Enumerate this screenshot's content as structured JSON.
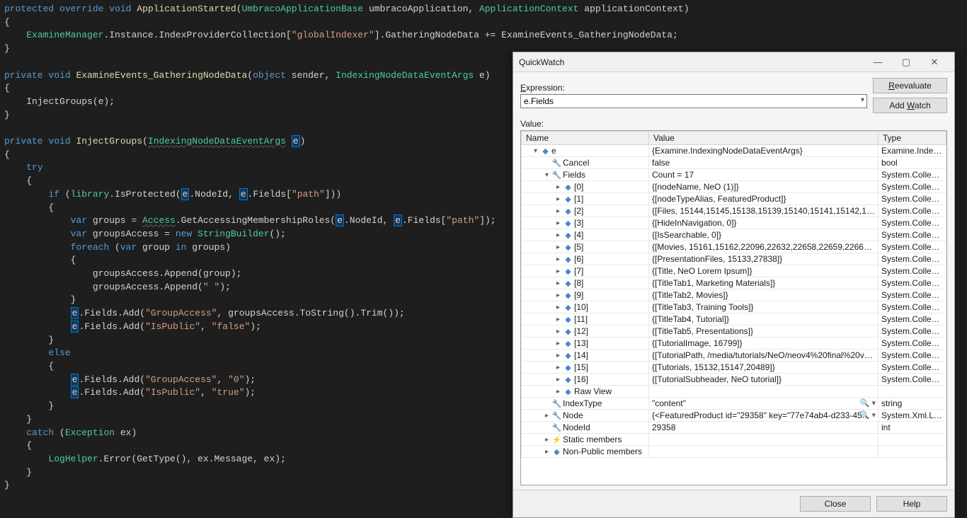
{
  "code_tokens": [
    [
      [
        "kw",
        "protected"
      ],
      [
        "plain",
        " "
      ],
      [
        "kw",
        "override"
      ],
      [
        "plain",
        " "
      ],
      [
        "kw",
        "void"
      ],
      [
        "plain",
        " "
      ],
      [
        "ident",
        "ApplicationStarted"
      ],
      [
        "punct",
        "("
      ],
      [
        "type",
        "UmbracoApplicationBase"
      ],
      [
        "plain",
        " umbracoApplication, "
      ],
      [
        "type",
        "ApplicationContext"
      ],
      [
        "plain",
        " applicationContext"
      ],
      [
        "punct",
        ")"
      ]
    ],
    [
      [
        "punct",
        "{"
      ]
    ],
    [
      [
        "plain",
        "    "
      ],
      [
        "type",
        "ExamineManager"
      ],
      [
        "plain",
        ".Instance.IndexProviderCollection["
      ],
      [
        "str",
        "\"globalIndexer\""
      ],
      [
        "plain",
        "].GatheringNodeData += ExamineEvents_GatheringNodeData;"
      ]
    ],
    [
      [
        "punct",
        "}"
      ]
    ],
    [
      [
        "plain",
        ""
      ]
    ],
    [
      [
        "kw",
        "private"
      ],
      [
        "plain",
        " "
      ],
      [
        "kw",
        "void"
      ],
      [
        "plain",
        " "
      ],
      [
        "ident",
        "ExamineEvents_GatheringNodeData"
      ],
      [
        "punct",
        "("
      ],
      [
        "kw",
        "object"
      ],
      [
        "plain",
        " sender, "
      ],
      [
        "type",
        "IndexingNodeDataEventArgs"
      ],
      [
        "plain",
        " e"
      ],
      [
        "punct",
        ")"
      ]
    ],
    [
      [
        "punct",
        "{"
      ]
    ],
    [
      [
        "plain",
        "    InjectGroups(e);"
      ]
    ],
    [
      [
        "punct",
        "}"
      ]
    ],
    [
      [
        "plain",
        ""
      ]
    ],
    [
      [
        "kw",
        "private"
      ],
      [
        "plain",
        " "
      ],
      [
        "kw",
        "void"
      ],
      [
        "plain",
        " "
      ],
      [
        "ident",
        "InjectGroups"
      ],
      [
        "punct",
        "("
      ],
      [
        "type underline",
        "IndexingNodeDataEventArgs"
      ],
      [
        "plain",
        " "
      ],
      [
        "param-hl",
        "e"
      ],
      [
        "punct",
        ")"
      ]
    ],
    [
      [
        "punct",
        "{"
      ]
    ],
    [
      [
        "plain",
        "    "
      ],
      [
        "kw",
        "try"
      ]
    ],
    [
      [
        "plain",
        "    "
      ],
      [
        "punct",
        "{"
      ]
    ],
    [
      [
        "plain",
        "        "
      ],
      [
        "kw",
        "if"
      ],
      [
        "plain",
        " ("
      ],
      [
        "type",
        "library"
      ],
      [
        "plain",
        ".IsProtected("
      ],
      [
        "param-hl",
        "e"
      ],
      [
        "plain",
        ".NodeId, "
      ],
      [
        "param-hl",
        "e"
      ],
      [
        "plain",
        ".Fields["
      ],
      [
        "str",
        "\"path\""
      ],
      [
        "plain",
        "]))"
      ]
    ],
    [
      [
        "plain",
        "        "
      ],
      [
        "punct",
        "{"
      ]
    ],
    [
      [
        "plain",
        "            "
      ],
      [
        "kw",
        "var"
      ],
      [
        "plain",
        " groups = "
      ],
      [
        "type underline",
        "Access"
      ],
      [
        "plain",
        ".GetAccessingMembershipRoles("
      ],
      [
        "param-hl",
        "e"
      ],
      [
        "plain",
        ".NodeId, "
      ],
      [
        "param-hl",
        "e"
      ],
      [
        "plain",
        ".Fields["
      ],
      [
        "str",
        "\"path\""
      ],
      [
        "plain",
        "]);"
      ]
    ],
    [
      [
        "plain",
        "            "
      ],
      [
        "kw",
        "var"
      ],
      [
        "plain",
        " groupsAccess = "
      ],
      [
        "kw",
        "new"
      ],
      [
        "plain",
        " "
      ],
      [
        "type",
        "StringBuilder"
      ],
      [
        "plain",
        "();"
      ]
    ],
    [
      [
        "plain",
        "            "
      ],
      [
        "kw",
        "foreach"
      ],
      [
        "plain",
        " ("
      ],
      [
        "kw",
        "var"
      ],
      [
        "plain",
        " group "
      ],
      [
        "kw",
        "in"
      ],
      [
        "plain",
        " groups)"
      ]
    ],
    [
      [
        "plain",
        "            "
      ],
      [
        "punct",
        "{"
      ]
    ],
    [
      [
        "plain",
        "                groupsAccess.Append(group);"
      ]
    ],
    [
      [
        "plain",
        "                groupsAccess.Append("
      ],
      [
        "str",
        "\" \""
      ],
      [
        "plain",
        ");"
      ]
    ],
    [
      [
        "plain",
        "            "
      ],
      [
        "punct",
        "}"
      ]
    ],
    [
      [
        "plain",
        "            "
      ],
      [
        "param-hl",
        "e"
      ],
      [
        "plain",
        ".Fields.Add("
      ],
      [
        "str",
        "\"GroupAccess\""
      ],
      [
        "plain",
        ", groupsAccess.ToString().Trim());"
      ]
    ],
    [
      [
        "plain",
        "            "
      ],
      [
        "param-hl",
        "e"
      ],
      [
        "plain",
        ".Fields.Add("
      ],
      [
        "str",
        "\"IsPublic\""
      ],
      [
        "plain",
        ", "
      ],
      [
        "str",
        "\"false\""
      ],
      [
        "plain",
        ");"
      ]
    ],
    [
      [
        "plain",
        "        "
      ],
      [
        "punct",
        "}"
      ]
    ],
    [
      [
        "plain",
        "        "
      ],
      [
        "kw",
        "else"
      ]
    ],
    [
      [
        "plain",
        "        "
      ],
      [
        "punct",
        "{"
      ]
    ],
    [
      [
        "plain",
        "            "
      ],
      [
        "param-hl",
        "e"
      ],
      [
        "plain",
        ".Fields.Add("
      ],
      [
        "str",
        "\"GroupAccess\""
      ],
      [
        "plain",
        ", "
      ],
      [
        "str",
        "\"0\""
      ],
      [
        "plain",
        ");"
      ]
    ],
    [
      [
        "plain",
        "            "
      ],
      [
        "param-hl",
        "e"
      ],
      [
        "plain",
        ".Fields.Add("
      ],
      [
        "str",
        "\"IsPublic\""
      ],
      [
        "plain",
        ", "
      ],
      [
        "str",
        "\"true\""
      ],
      [
        "plain",
        ");"
      ]
    ],
    [
      [
        "plain",
        "        "
      ],
      [
        "punct",
        "}"
      ]
    ],
    [
      [
        "plain",
        "    "
      ],
      [
        "punct",
        "}"
      ]
    ],
    [
      [
        "plain",
        "    "
      ],
      [
        "kw",
        "catch"
      ],
      [
        "plain",
        " ("
      ],
      [
        "type",
        "Exception"
      ],
      [
        "plain",
        " ex)"
      ]
    ],
    [
      [
        "plain",
        "    "
      ],
      [
        "punct",
        "{"
      ]
    ],
    [
      [
        "plain",
        "        "
      ],
      [
        "type",
        "LogHelper"
      ],
      [
        "plain",
        ".Error(GetType(), ex.Message, ex);"
      ]
    ],
    [
      [
        "plain",
        "    "
      ],
      [
        "punct",
        "}"
      ]
    ],
    [
      [
        "punct",
        "}"
      ]
    ]
  ],
  "qw": {
    "title": "QuickWatch",
    "expression_label": "Expression:",
    "expression_value": "e.Fields",
    "value_label": "Value:",
    "reevaluate": "Reevaluate",
    "addwatch": "Add Watch",
    "columns": {
      "name": "Name",
      "value": "Value",
      "type": "Type"
    },
    "close": "Close",
    "help": "Help",
    "rows": [
      {
        "indent": 0,
        "exp": "▾",
        "icon": "cube",
        "name": "e",
        "value": "{Examine.IndexingNodeDataEventArgs}",
        "type": "Examine.IndexingNodeDataEventArgs"
      },
      {
        "indent": 1,
        "exp": "",
        "icon": "wrench",
        "name": "Cancel",
        "value": "false",
        "type": "bool"
      },
      {
        "indent": 1,
        "exp": "▾",
        "icon": "wrench",
        "name": "Fields",
        "value": "Count = 17",
        "type": "System.Collections.Generic.Dictionary<string,string>"
      },
      {
        "indent": 2,
        "exp": "▸",
        "icon": "cube",
        "name": "[0]",
        "value": "{[nodeName, NeO (1)]}",
        "type": "System.Collections.Generic.KeyValuePair<string,string>"
      },
      {
        "indent": 2,
        "exp": "▸",
        "icon": "cube",
        "name": "[1]",
        "value": "{[nodeTypeAlias, FeaturedProduct]}",
        "type": "System.Collections.Generic.KeyValuePair<string,string>"
      },
      {
        "indent": 2,
        "exp": "▸",
        "icon": "cube",
        "name": "[2]",
        "value": "{[Files, 15144,15145,15138,15139,15140,15141,15142,15143,15...]}",
        "type": "System.Collections.Generic.KeyValuePair<string,string>"
      },
      {
        "indent": 2,
        "exp": "▸",
        "icon": "cube",
        "name": "[3]",
        "value": "{[HideInNavigation, 0]}",
        "type": "System.Collections.Generic.KeyValuePair<string,string>"
      },
      {
        "indent": 2,
        "exp": "▸",
        "icon": "cube",
        "name": "[4]",
        "value": "{[IsSearchable, 0]}",
        "type": "System.Collections.Generic.KeyValuePair<string,string>"
      },
      {
        "indent": 2,
        "exp": "▸",
        "icon": "cube",
        "name": "[5]",
        "value": "{[Movies, 15161,15162,22096,22632,22658,22659,22660,22669,...]}",
        "type": "System.Collections.Generic.KeyValuePair<string,string>"
      },
      {
        "indent": 2,
        "exp": "▸",
        "icon": "cube",
        "name": "[6]",
        "value": "{[PresentationFiles, 15133,27838]}",
        "type": "System.Collections.Generic.KeyValuePair<string,string>"
      },
      {
        "indent": 2,
        "exp": "▸",
        "icon": "cube",
        "name": "[7]",
        "value": "{[Title, NeO Lorem Ipsum]}",
        "type": "System.Collections.Generic.KeyValuePair<string,string>"
      },
      {
        "indent": 2,
        "exp": "▸",
        "icon": "cube",
        "name": "[8]",
        "value": "{[TitleTab1, Marketing Materials]}",
        "type": "System.Collections.Generic.KeyValuePair<string,string>"
      },
      {
        "indent": 2,
        "exp": "▸",
        "icon": "cube",
        "name": "[9]",
        "value": "{[TitleTab2, Movies]}",
        "type": "System.Collections.Generic.KeyValuePair<string,string>"
      },
      {
        "indent": 2,
        "exp": "▸",
        "icon": "cube",
        "name": "[10]",
        "value": "{[TitleTab3, Training Tools]}",
        "type": "System.Collections.Generic.KeyValuePair<string,string>"
      },
      {
        "indent": 2,
        "exp": "▸",
        "icon": "cube",
        "name": "[11]",
        "value": "{[TitleTab4, Tutorial]}",
        "type": "System.Collections.Generic.KeyValuePair<string,string>"
      },
      {
        "indent": 2,
        "exp": "▸",
        "icon": "cube",
        "name": "[12]",
        "value": "{[TitleTab5, Presentations]}",
        "type": "System.Collections.Generic.KeyValuePair<string,string>"
      },
      {
        "indent": 2,
        "exp": "▸",
        "icon": "cube",
        "name": "[13]",
        "value": "{[TutorialImage, 16799]}",
        "type": "System.Collections.Generic.KeyValuePair<string,string>"
      },
      {
        "indent": 2,
        "exp": "▸",
        "icon": "cube",
        "name": "[14]",
        "value": "{[TutorialPath, /media/tutorials/NeO/neov4%20final%20vers...]}",
        "type": "System.Collections.Generic.KeyValuePair<string,string>"
      },
      {
        "indent": 2,
        "exp": "▸",
        "icon": "cube",
        "name": "[15]",
        "value": "{[Tutorials, 15132,15147,20489]}",
        "type": "System.Collections.Generic.KeyValuePair<string,string>"
      },
      {
        "indent": 2,
        "exp": "▸",
        "icon": "cube",
        "name": "[16]",
        "value": "{[TutorialSubheader, NeO tutorial]}",
        "type": "System.Collections.Generic.KeyValuePair<string,string>"
      },
      {
        "indent": 2,
        "exp": "▸",
        "icon": "cube",
        "name": "Raw View",
        "value": "",
        "type": ""
      },
      {
        "indent": 1,
        "exp": "",
        "icon": "wrench",
        "name": "IndexType",
        "value": "\"content\"",
        "type": "string",
        "mag": true
      },
      {
        "indent": 1,
        "exp": "▸",
        "icon": "wrench",
        "name": "Node",
        "value": "{<FeaturedProduct id=\"29358\" key=\"77e74ab4-d233-45...",
        "type": "System.Xml.Linq.XElement",
        "mag": true
      },
      {
        "indent": 1,
        "exp": "",
        "icon": "wrench",
        "name": "NodeId",
        "value": "29358",
        "type": "int"
      },
      {
        "indent": 1,
        "exp": "▸",
        "icon": "static",
        "name": "Static members",
        "value": "",
        "type": ""
      },
      {
        "indent": 1,
        "exp": "▸",
        "icon": "cube",
        "name": "Non-Public members",
        "value": "",
        "type": ""
      }
    ]
  }
}
